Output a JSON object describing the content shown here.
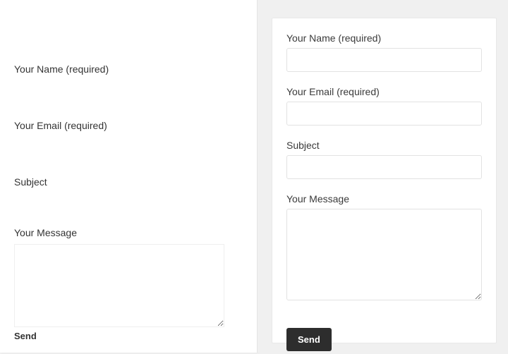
{
  "left": {
    "name_label": "Your Name (required)",
    "email_label": "Your Email (required)",
    "subject_label": "Subject",
    "message_label": "Your Message",
    "send_label": "Send"
  },
  "right": {
    "name_label": "Your Name (required)",
    "email_label": "Your Email (required)",
    "subject_label": "Subject",
    "message_label": "Your Message",
    "send_label": "Send"
  }
}
